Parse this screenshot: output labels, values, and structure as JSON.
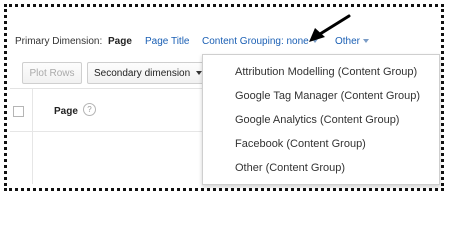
{
  "primary_dimension": {
    "label": "Primary Dimension:",
    "current": "Page",
    "options": [
      "Page Title",
      "Content Grouping: none",
      "Other"
    ]
  },
  "toolbar": {
    "plot_rows": "Plot Rows",
    "secondary_dimension": "Secondary dimension"
  },
  "table": {
    "column_header": "Page",
    "help_glyph": "?"
  },
  "content_grouping_menu": {
    "items": [
      "Attribution Modelling (Content Group)",
      "Google Tag Manager (Content Group)",
      "Google Analytics (Content Group)",
      "Facebook (Content Group)",
      "Other (Content Group)"
    ]
  },
  "icons": {
    "pointer": "black-arrow-icon",
    "caret": "caret-down-icon",
    "help": "help-icon"
  },
  "colors": {
    "link": "#1a5fb4",
    "caret": "#7a9cc6",
    "frame": "#111111"
  }
}
